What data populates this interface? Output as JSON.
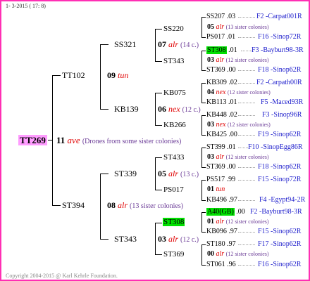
{
  "header": {
    "date_line": "1-  3-2015 ( 17: 8)"
  },
  "copyright": "Copyright 2004-2015 @ Karl Kehrle Foundation.",
  "root": {
    "id": "TT269",
    "num": "11",
    "label": "ave",
    "note": "(Drones from some sister colonies)"
  },
  "gen1": [
    {
      "id": "TT102",
      "num": "09",
      "label": "tun",
      "note": ""
    },
    {
      "id": "ST394",
      "num": "08",
      "label": "alr",
      "note": "(13 sister colonies)"
    }
  ],
  "gen2": [
    {
      "id": "SS321",
      "num": "07",
      "label": "alr",
      "note": "(14 c.)"
    },
    {
      "id": "KB139",
      "num": "06",
      "label": "nex",
      "note": "(12 c.)"
    },
    {
      "id": "ST339",
      "num": "05",
      "label": "alr",
      "note": "(13 c.)"
    },
    {
      "id": "ST343",
      "num": "03",
      "label": "alr",
      "note": "(12 c.)"
    }
  ],
  "gen3": [
    {
      "id": "SS220",
      "num": "05",
      "label": "alr",
      "note": "(13 sister colonies)"
    },
    {
      "id": "ST343",
      "num": "03",
      "label": "alr",
      "note": "(12 sister colonies)"
    },
    {
      "id": "KB075",
      "num": "04",
      "label": "nex",
      "note": "(12 sister colonies)"
    },
    {
      "id": "KB266",
      "num": "03",
      "label": "nex",
      "note": "(12 sister colonies)"
    },
    {
      "id": "ST433",
      "num": "03",
      "label": "alr",
      "note": "(12 sister colonies)"
    },
    {
      "id": "PS017",
      "num": "01",
      "label": "tun",
      "note": ""
    },
    {
      "id": "ST308",
      "num": "01",
      "label": "alr",
      "note": "(12 sister colonies)"
    },
    {
      "id": "ST369",
      "num": "00",
      "label": "alr",
      "note": "(12 sister colonies)"
    }
  ],
  "gen4": [
    {
      "id": "SS207",
      "val": ".03",
      "ref": "F2 -Carpat001R"
    },
    {
      "id": "PS017",
      "val": ".01",
      "ref": "F16 -Sinop72R"
    },
    {
      "id": "ST308",
      "val": ".01",
      "ref": "F3 -Bayburt98-3R"
    },
    {
      "id": "ST369",
      "val": ".00",
      "ref": "F18 -Sinop62R"
    },
    {
      "id": "KB309",
      "val": ".02",
      "ref": "F2 -Carpath00R"
    },
    {
      "id": "KB113",
      "val": ".01",
      "ref": "F5 -Maced93R"
    },
    {
      "id": "KB448",
      "val": ".02",
      "ref": "F3 -Sinop96R"
    },
    {
      "id": "KB425",
      "val": ".00",
      "ref": "F19 -Sinop62R"
    },
    {
      "id": "ST399",
      "val": ".01",
      "ref": "F10 -SinopEgg86R"
    },
    {
      "id": "ST369",
      "val": ".00",
      "ref": "F18 -Sinop62R"
    },
    {
      "id": "PS517",
      "val": ".99",
      "ref": "F15 -Sinop72R"
    },
    {
      "id": "KB496",
      "val": ".97",
      "ref": "F4 -Egypt94-2R"
    },
    {
      "id": "A40(GB)",
      "val": ".00",
      "ref": "F2 -Bayburt98-3R"
    },
    {
      "id": "KB096",
      "val": ".97",
      "ref": "F15 -Sinop62R"
    },
    {
      "id": "ST180",
      "val": ".97",
      "ref": "F17 -Sinop62R"
    },
    {
      "id": "ST061",
      "val": ".96",
      "ref": "F16 -Sinop62R"
    }
  ]
}
